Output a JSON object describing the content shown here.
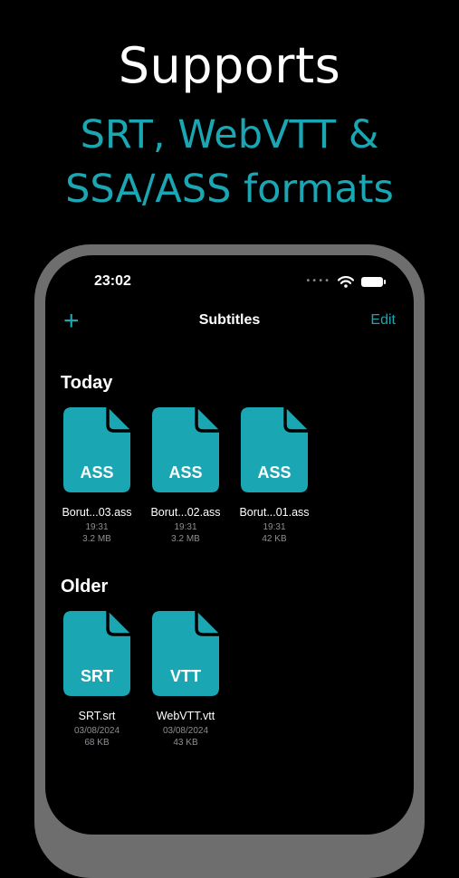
{
  "promo": {
    "headline": "Supports",
    "subline1": "SRT, WebVTT &",
    "subline2": "SSA/ASS formats"
  },
  "status": {
    "time": "23:02"
  },
  "nav": {
    "add_label": "+",
    "title": "Subtitles",
    "edit_label": "Edit"
  },
  "sections": {
    "today": {
      "title": "Today",
      "files": [
        {
          "badge": "ASS",
          "name": "Borut...03.ass",
          "time": "19:31",
          "size": "3.2 MB"
        },
        {
          "badge": "ASS",
          "name": "Borut...02.ass",
          "time": "19:31",
          "size": "3.2 MB"
        },
        {
          "badge": "ASS",
          "name": "Borut...01.ass",
          "time": "19:31",
          "size": "42 KB"
        }
      ]
    },
    "older": {
      "title": "Older",
      "files": [
        {
          "badge": "SRT",
          "name": "SRT.srt",
          "time": "03/08/2024",
          "size": "68 KB"
        },
        {
          "badge": "VTT",
          "name": "WebVTT.vtt",
          "time": "03/08/2024",
          "size": "43 KB"
        }
      ]
    }
  },
  "colors": {
    "accent": "#1aa7b3",
    "background": "#000000",
    "frame": "#6e6e6e"
  },
  "icons": {
    "file": "document-icon",
    "wifi": "wifi-icon",
    "battery": "battery-icon",
    "add": "plus-icon"
  }
}
